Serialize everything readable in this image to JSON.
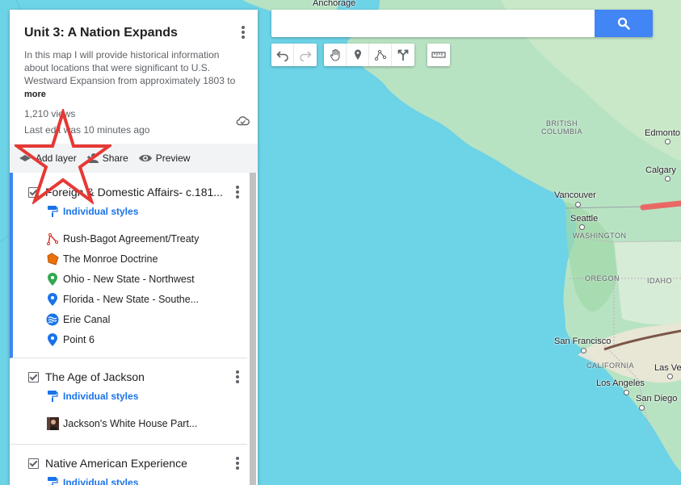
{
  "map": {
    "labels": {
      "anchorage": "Anchorage",
      "british_columbia": "BRITISH\nCOLUMBIA",
      "edmonton": "Edmonto",
      "calgary": "Calgary",
      "vancouver": "Vancouver",
      "seattle": "Seattle",
      "washington": "WASHINGTON",
      "oregon": "OREGON",
      "idaho": "IDAHO",
      "san_francisco": "San Francisco",
      "california": "CALIFORNIA",
      "las_vegas": "Las Veg",
      "los_angeles": "Los Angeles",
      "san_diego": "San Diego"
    }
  },
  "search": {
    "placeholder": "",
    "button_icon": "search-icon"
  },
  "toolbar": {
    "icons": [
      "undo-icon",
      "redo-icon",
      "hand-icon",
      "marker-icon",
      "draw-line-icon",
      "directions-icon",
      "ruler-icon"
    ]
  },
  "panel": {
    "title": "Unit 3: A Nation Expands",
    "description": "In this map I will provide historical information about locations that were significant to U.S. Westward Expansion from approximately 1803 to",
    "more": "more",
    "views": "1,210 views",
    "last_edit": "Last edit was 10 minutes ago",
    "actions": {
      "add_layer": "Add layer",
      "share": "Share",
      "preview": "Preview"
    },
    "layers": [
      {
        "name": "Foreign & Domestic Affairs- c.181...",
        "styles": "Individual styles",
        "features": [
          {
            "label": "Rush-Bagot Agreement/Treaty",
            "icon": "line-icon",
            "color": "#d93025"
          },
          {
            "label": "The Monroe Doctrine",
            "icon": "polygon-icon",
            "color": "#e8710a"
          },
          {
            "label": "Ohio - New State - Northwest",
            "icon": "pin-icon",
            "color": "#34a853"
          },
          {
            "label": "Florida - New State - Southe...",
            "icon": "pin-icon",
            "color": "#1a73e8"
          },
          {
            "label": "Erie Canal",
            "icon": "water-icon",
            "color": "#1a73e8"
          },
          {
            "label": "Point 6",
            "icon": "pin-icon",
            "color": "#1a73e8"
          }
        ]
      },
      {
        "name": "The Age of Jackson",
        "styles": "Individual styles",
        "features": [
          {
            "label": "Jackson's White House Part...",
            "icon": "image-thumb-icon",
            "color": "#5d4037"
          }
        ]
      },
      {
        "name": "Native American Experience",
        "styles": "Individual styles",
        "features": []
      }
    ]
  },
  "colors": {
    "accent": "#4285f4",
    "link": "#1a73e8",
    "annotation_star": "#e53935",
    "water": "#6dd3e6",
    "land": "#b8e3c3"
  }
}
